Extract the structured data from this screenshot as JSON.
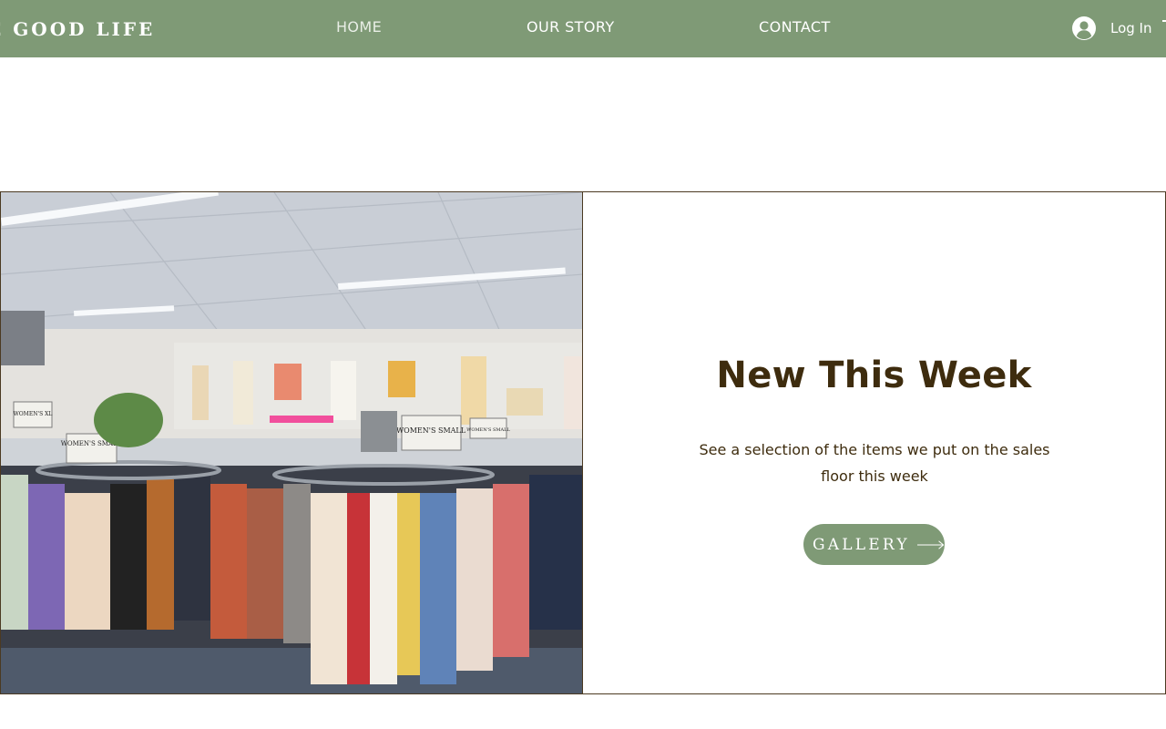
{
  "header": {
    "brand": "E GOOD LIFE",
    "nav": [
      {
        "label": "HOME"
      },
      {
        "label": "OUR STORY"
      },
      {
        "label": "CONTACT"
      }
    ],
    "login_label": "Log In",
    "login_icon": "user-avatar-icon"
  },
  "feature": {
    "image_signs": [
      "WOMEN'S SMALL",
      "WOMEN'S SMALL",
      "WOMEN'S XL",
      "WOMEN'S SMALL"
    ],
    "title": "New This Week",
    "description": "See a selection of the items we put on the sales floor this week",
    "button_label": "GALLERY",
    "button_icon": "arrow-right-icon"
  },
  "colors": {
    "header_bg": "#7f9a76",
    "button_bg": "#7f9a76",
    "text_brown": "#3e2c0e",
    "border": "#4b3a22"
  }
}
